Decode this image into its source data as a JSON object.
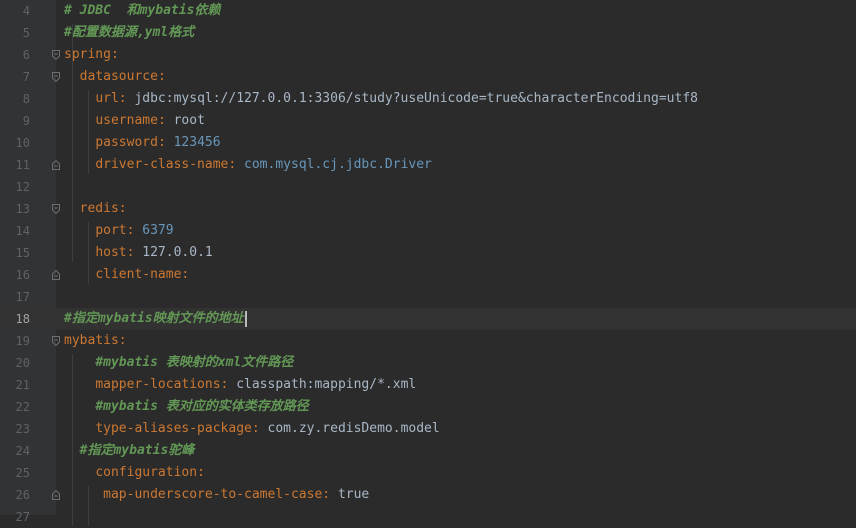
{
  "editor": {
    "lines": [
      {
        "n": "4",
        "text": "# JDBC  和mybatis依赖",
        "kind": "comment",
        "indent": ""
      },
      {
        "n": "5",
        "text": "#配置数据源,yml格式",
        "kind": "comment",
        "indent": ""
      },
      {
        "n": "6",
        "key": "spring",
        "sep": ":",
        "val": "",
        "kind": "kv",
        "indent": ""
      },
      {
        "n": "7",
        "key": "datasource",
        "sep": ":",
        "val": "",
        "kind": "kv",
        "indent": "  "
      },
      {
        "n": "8",
        "key": "url",
        "sep": ": ",
        "val": "jdbc:mysql://127.0.0.1:3306/study?useUnicode=true&characterEncoding=utf8",
        "kind": "kv",
        "indent": "    "
      },
      {
        "n": "9",
        "key": "username",
        "sep": ": ",
        "val": "root",
        "kind": "kv",
        "indent": "    "
      },
      {
        "n": "10",
        "key": "password",
        "sep": ": ",
        "val": "123456",
        "kind": "kv",
        "indent": "    "
      },
      {
        "n": "11",
        "key": "driver-class-name",
        "sep": ": ",
        "val": "com.mysql.cj.jdbc.Driver",
        "kind": "kv",
        "indent": "    "
      },
      {
        "n": "12",
        "text": "",
        "kind": "empty",
        "indent": ""
      },
      {
        "n": "13",
        "key": "redis",
        "sep": ":",
        "val": "",
        "kind": "kv",
        "indent": "  "
      },
      {
        "n": "14",
        "key": "port",
        "sep": ": ",
        "val": "6379",
        "kind": "kv",
        "indent": "    "
      },
      {
        "n": "15",
        "key": "host",
        "sep": ": ",
        "val": "127.0.0.1",
        "kind": "kv",
        "indent": "    "
      },
      {
        "n": "16",
        "key": "client-name",
        "sep": ":",
        "val": "",
        "kind": "kv",
        "indent": "    "
      },
      {
        "n": "17",
        "text": "",
        "kind": "empty",
        "indent": ""
      },
      {
        "n": "18",
        "text": "#指定mybatis映射文件的地址",
        "kind": "comment",
        "indent": ""
      },
      {
        "n": "19",
        "key": "mybatis",
        "sep": ":",
        "val": "",
        "kind": "kv",
        "indent": ""
      },
      {
        "n": "20",
        "text": "#mybatis 表映射的xml文件路径",
        "kind": "comment",
        "indent": "    "
      },
      {
        "n": "21",
        "key": "mapper-locations",
        "sep": ": ",
        "val": "classpath:mapping/*.xml",
        "kind": "kv",
        "indent": "    "
      },
      {
        "n": "22",
        "text": "#mybatis 表对应的实体类存放路径",
        "kind": "comment",
        "indent": "    "
      },
      {
        "n": "23",
        "key": "type-aliases-package",
        "sep": ": ",
        "val": "com.zy.redisDemo.model",
        "kind": "kv",
        "indent": "    "
      },
      {
        "n": "24",
        "text": "#指定mybatis驼峰",
        "kind": "comment",
        "indent": "  "
      },
      {
        "n": "25",
        "key": "configuration",
        "sep": ":",
        "val": "",
        "kind": "kv",
        "indent": "    "
      },
      {
        "n": "26",
        "key": "map-underscore-to-camel-case",
        "sep": ": ",
        "val": "true",
        "kind": "kv",
        "indent": "     "
      },
      {
        "n": "27",
        "text": "",
        "kind": "empty",
        "indent": ""
      }
    ],
    "current_line": "18",
    "colors": {
      "background": "#2b2b2b",
      "gutter": "#313335",
      "key": "#cc7832",
      "value": "#a9b7c6",
      "number": "#6897bb",
      "comment": "#629755"
    }
  }
}
